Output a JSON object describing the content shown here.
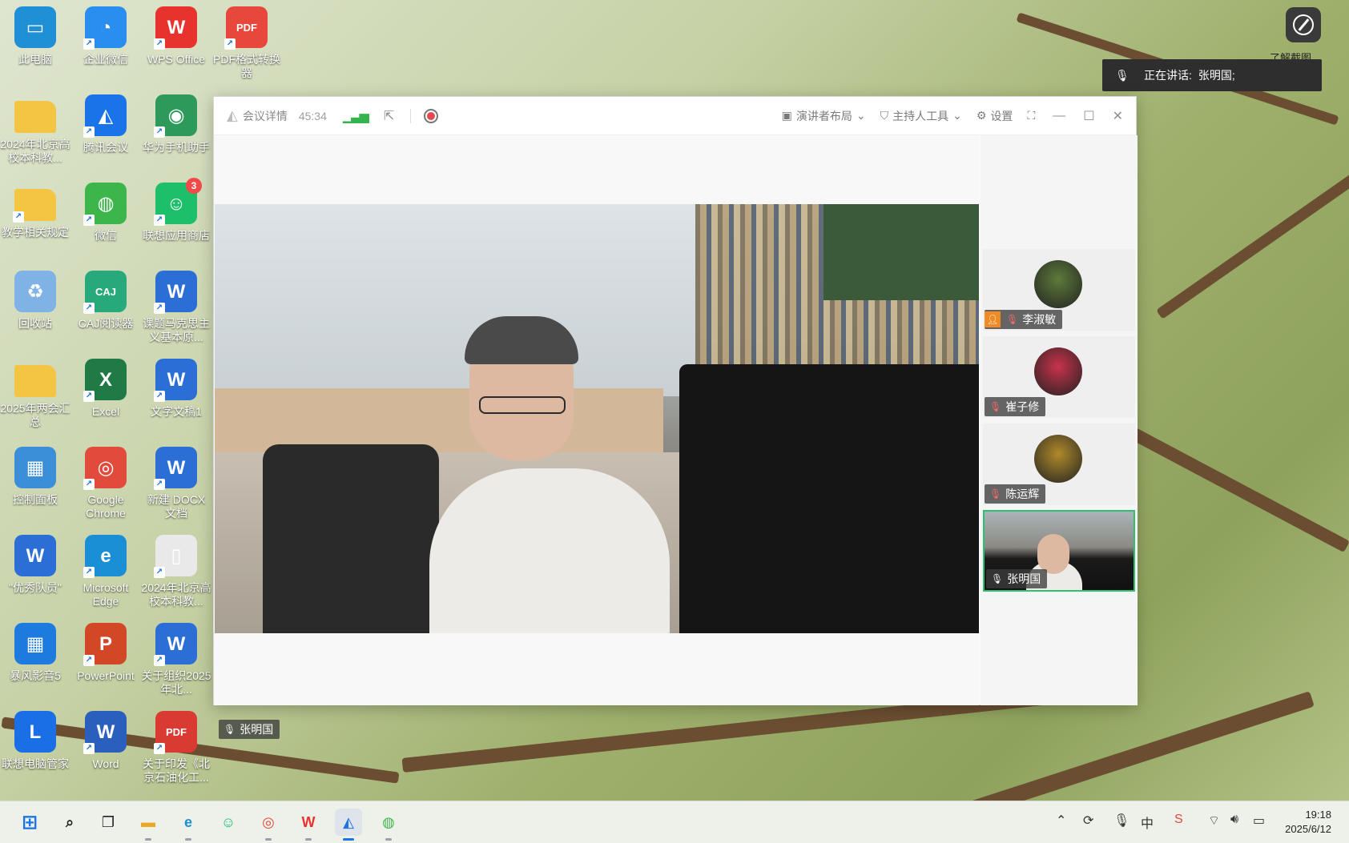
{
  "desktop": {
    "icons": [
      {
        "label": "此电脑",
        "glyph": "▭",
        "color": "#1f8fd6"
      },
      {
        "label": "企业微信",
        "glyph": "◔",
        "color": "#2a8df0"
      },
      {
        "label": "WPS Office",
        "glyph": "W",
        "color": "#e8322e"
      },
      {
        "label": "PDF格式转换器",
        "glyph": "PDF",
        "color": "#e8473c"
      },
      {
        "label": "2024年北京高校本科教...",
        "glyph": "",
        "color": "#f4c542"
      },
      {
        "label": "腾讯会议",
        "glyph": "◭",
        "color": "#1a73e8"
      },
      {
        "label": "华为手机助手",
        "glyph": "◉",
        "color": "#2d9a5a"
      },
      {
        "label": "教学相关规定",
        "glyph": "",
        "color": "#f4c542"
      },
      {
        "label": "微信",
        "glyph": "◍",
        "color": "#3cb64a"
      },
      {
        "label": "联想应用商店",
        "glyph": "☺",
        "color": "#1dbf6b",
        "badge": "3"
      },
      {
        "label": "回收站",
        "glyph": "♻",
        "color": "#7fb3e6"
      },
      {
        "label": "CAJ阅读器",
        "glyph": "CAJ",
        "color": "#27a97b"
      },
      {
        "label": "课题马克思主义基本原...",
        "glyph": "W",
        "color": "#2b6fd6"
      },
      {
        "label": "2025年两会汇总",
        "glyph": "",
        "color": "#f4c542"
      },
      {
        "label": "Excel",
        "glyph": "X",
        "color": "#1f7a45"
      },
      {
        "label": "文字文稿1",
        "glyph": "W",
        "color": "#2b6fd6"
      },
      {
        "label": "控制面板",
        "glyph": "▦",
        "color": "#3b8ed8"
      },
      {
        "label": "Google Chrome",
        "glyph": "◎",
        "color": "#e04b3c"
      },
      {
        "label": "新建 DOCX 文档",
        "glyph": "W",
        "color": "#2b6fd6"
      },
      {
        "label": "\"优秀队员\"",
        "glyph": "W",
        "color": "#2b6fd6"
      },
      {
        "label": "Microsoft Edge",
        "glyph": "e",
        "color": "#1b8fd6"
      },
      {
        "label": "2024年北京高校本科教...",
        "glyph": "▯",
        "color": "#e9e9e9"
      },
      {
        "label": "暴风影音5",
        "glyph": "▦",
        "color": "#1d7be0"
      },
      {
        "label": "PowerPoint",
        "glyph": "P",
        "color": "#d24726"
      },
      {
        "label": "关于组织2025年北...",
        "glyph": "W",
        "color": "#2b6fd6"
      },
      {
        "label": "联想电脑管家",
        "glyph": "L",
        "color": "#1a6fe6"
      },
      {
        "label": "Word",
        "glyph": "W",
        "color": "#2b5fbd"
      },
      {
        "label": "关于印发《北京石油化工...",
        "glyph": "PDF",
        "color": "#d93a32"
      }
    ]
  },
  "overlay": {
    "screenshot_label": "了解截图",
    "speaking_label": "正在讲话:",
    "speaking_name": "张明国;"
  },
  "meeting": {
    "title_item": "会议详情",
    "timer": "45:34",
    "layout_label": "演讲者布局",
    "host_tools_label": "主持人工具",
    "settings_label": "设置",
    "main_speaker": "张明国",
    "participants": [
      {
        "name": "李淑敏",
        "host": true,
        "muted": true,
        "avatar_color": "#5d7a3a"
      },
      {
        "name": "崔子修",
        "host": false,
        "muted": true,
        "avatar_color": "#c8324a"
      },
      {
        "name": "陈运辉",
        "host": false,
        "muted": true,
        "avatar_color": "#b08a2a"
      },
      {
        "name": "张明国",
        "host": false,
        "muted": false,
        "avatar_color": "#333333"
      }
    ]
  },
  "taskbar": {
    "clock_time": "19:18",
    "clock_date": "2025/6/12",
    "ime": "中"
  }
}
